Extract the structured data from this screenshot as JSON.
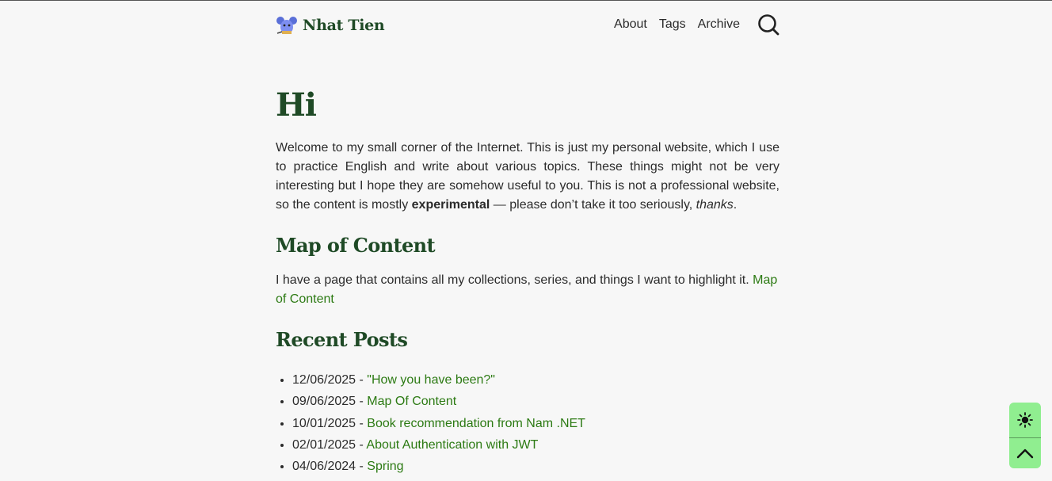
{
  "header": {
    "site_name": "Nhat Tien",
    "menu": [
      {
        "label": "About"
      },
      {
        "label": "Tags"
      },
      {
        "label": "Archive"
      }
    ]
  },
  "main": {
    "title": "Hi",
    "intro_start": "Welcome to my small corner of the Internet. This is just my personal website, which I use to practice English and write about various topics. These things might not be very interesting but I hope they are somehow useful to you. This is not a professional website, so the content is mostly ",
    "intro_bold": "experimental",
    "intro_mid": " — please don’t take it too seriously, ",
    "intro_italic": "thanks",
    "intro_end": ".",
    "moc_heading": "Map of Content",
    "moc_text": "I have a page that contains all my collections, series, and things I want to highlight it. ",
    "moc_link": "Map of Content",
    "recent_heading": "Recent Posts",
    "posts": [
      {
        "date": "12/06/2025 - ",
        "title": "\"How you have been?\""
      },
      {
        "date": "09/06/2025 - ",
        "title": "Map Of Content"
      },
      {
        "date": "10/01/2025 - ",
        "title": "Book recommendation from Nam .NET"
      },
      {
        "date": "02/01/2025 - ",
        "title": "About Authentication with JWT"
      },
      {
        "date": "04/06/2024 - ",
        "title": "Spring"
      }
    ]
  },
  "colors": {
    "heading": "#1f4a26",
    "link": "#2c7a13",
    "background": "#f7f7f7",
    "float_button": "#90ee90"
  },
  "icons": [
    "mouse-logo-icon",
    "search-icon",
    "sun-icon",
    "chevron-up-icon"
  ]
}
